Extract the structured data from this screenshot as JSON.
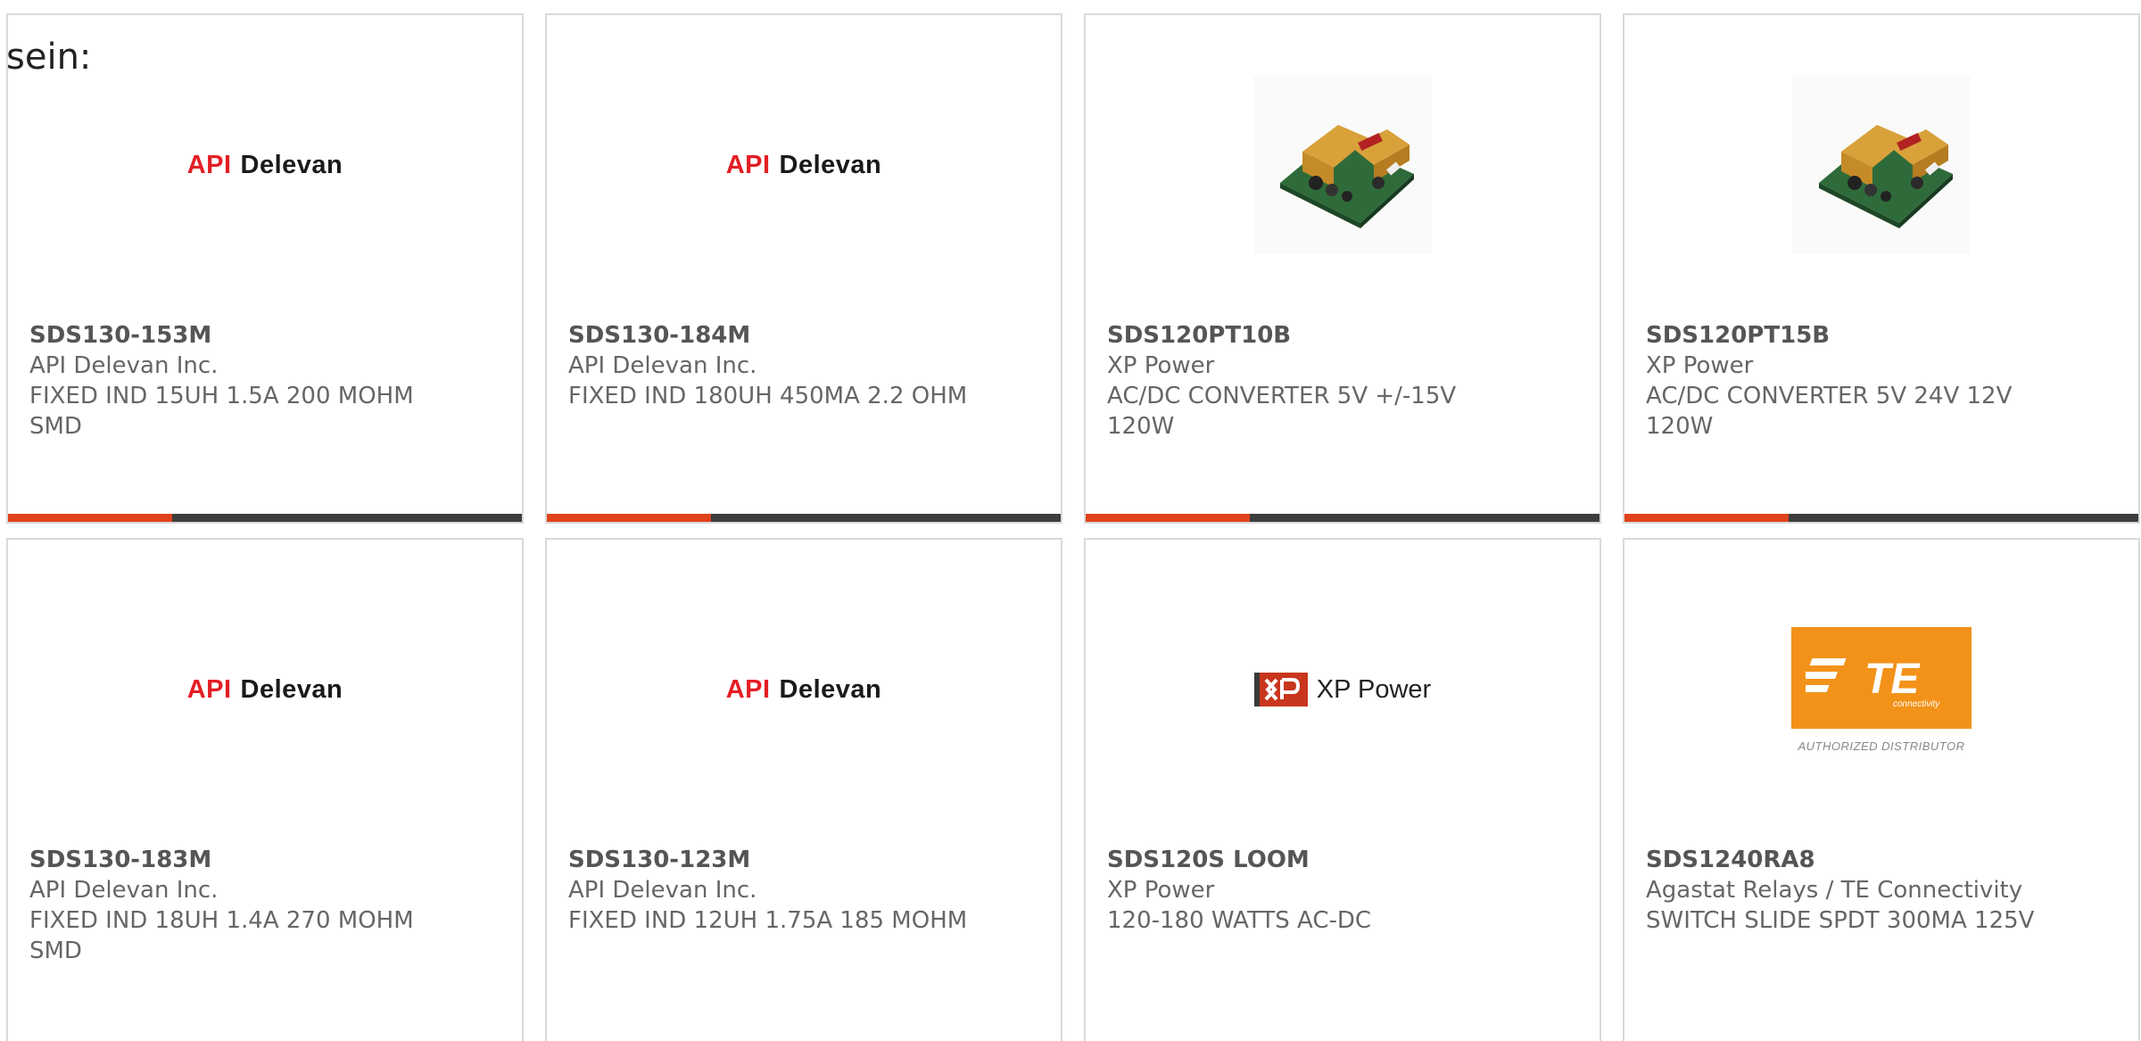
{
  "lead_text": "sein:",
  "products": [
    {
      "part_number": "SDS130-153M",
      "manufacturer": "API Delevan Inc.",
      "description": "FIXED IND 15UH 1.5A 200 MOHM SMD",
      "image": "api-delevan-logo",
      "has_bar": true
    },
    {
      "part_number": "SDS130-184M",
      "manufacturer": "API Delevan Inc.",
      "description": "FIXED IND 180UH 450MA 2.2 OHM",
      "image": "api-delevan-logo",
      "has_bar": true
    },
    {
      "part_number": "SDS120PT10B",
      "manufacturer": "XP Power",
      "description": "AC/DC CONVERTER 5V +/-15V 120W",
      "image": "power-supply-photo",
      "has_bar": true
    },
    {
      "part_number": "SDS120PT15B",
      "manufacturer": "XP Power",
      "description": "AC/DC CONVERTER 5V 24V 12V 120W",
      "image": "power-supply-photo",
      "has_bar": true
    },
    {
      "part_number": "SDS130-183M",
      "manufacturer": "API Delevan Inc.",
      "description": "FIXED IND 18UH 1.4A 270 MOHM SMD",
      "image": "api-delevan-logo",
      "has_bar": false
    },
    {
      "part_number": "SDS130-123M",
      "manufacturer": "API Delevan Inc.",
      "description": "FIXED IND 12UH 1.75A 185 MOHM",
      "image": "api-delevan-logo",
      "has_bar": false
    },
    {
      "part_number": "SDS120S LOOM",
      "manufacturer": "XP Power",
      "description": "120-180 WATTS AC-DC",
      "image": "xp-power-logo",
      "has_bar": false
    },
    {
      "part_number": "SDS1240RA8",
      "manufacturer": "Agastat Relays / TE Connectivity",
      "description": "SWITCH SLIDE SPDT 300MA 125V",
      "image": "te-connectivity-logo",
      "has_bar": false
    }
  ],
  "logos": {
    "api_delevan": {
      "api": "API",
      "delevan": "Delevan"
    },
    "xp_power": {
      "mark": "XP",
      "word": "XP Power"
    },
    "te": {
      "mark": "TE",
      "sub": "connectivity",
      "caption": "AUTHORIZED DISTRIBUTOR"
    }
  },
  "card_bar": {
    "progress": 0.32,
    "fill_color": "#e0421b",
    "track_color": "#3d3d3d"
  },
  "colors": {
    "border": "#d9d9d9",
    "text": "#666666",
    "part_number": "#555555",
    "api_red": "#e31e24",
    "xp_red": "#c8361d",
    "te_orange": "#f39219"
  }
}
